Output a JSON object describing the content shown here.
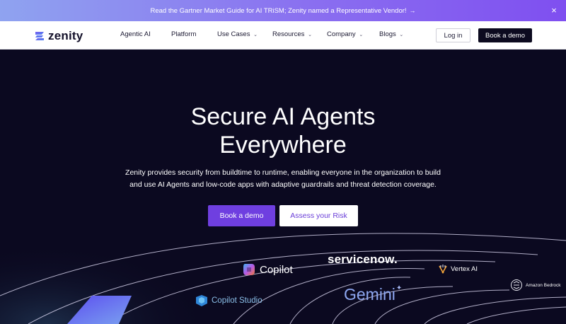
{
  "announcement": {
    "text": "Read the Gartner Market Guide for AI TRiSM; Zenity named a Representative Vendor!",
    "arrow": "→",
    "close_icon": "×"
  },
  "nav": {
    "logo_text": "zenity",
    "items": [
      {
        "label": "Agentic AI"
      },
      {
        "label": "Platform"
      },
      {
        "label": "Use Cases",
        "chevron": "⌄"
      },
      {
        "label": "Resources",
        "chevron": "⌄"
      },
      {
        "label": "Company",
        "chevron": "⌄"
      },
      {
        "label": "Blogs",
        "chevron": "⌄"
      }
    ],
    "login_label": "Log in",
    "demo_label": "Book a demo"
  },
  "hero": {
    "title_line1": "Secure AI Agents",
    "title_line2": "Everywhere",
    "subtitle_line1": "Zenity provides security from buildtime to runtime, enabling everyone in the organization to build",
    "subtitle_line2": "and use AI Agents and low-code apps with adaptive guardrails and threat detection coverage.",
    "primary_cta": "Book a demo",
    "secondary_cta": "Assess your Risk"
  },
  "brands": {
    "copilot": "Copilot",
    "servicenow": "servicenow.",
    "gemini": "Gemini",
    "copilot_studio": "Copilot Studio",
    "vertex": "Vertex AI",
    "bedrock": "Amazon Bedrock"
  },
  "colors": {
    "hero_bg": "#0b0920",
    "accent": "#6f3fe0",
    "announce_start": "#8fa3f0",
    "announce_end": "#7f4ff0"
  }
}
